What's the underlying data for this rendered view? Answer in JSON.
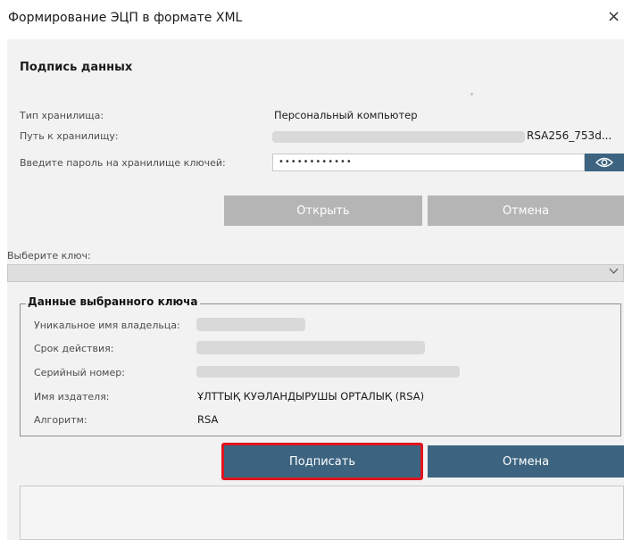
{
  "window": {
    "title": "Формирование ЭЦП в формате XML",
    "close_glyph": "×"
  },
  "section": {
    "heading": "Подпись данных"
  },
  "storage": {
    "type_label": "Тип хранилища:",
    "type_value": "Персональный компьютер",
    "path_label": "Путь к хранилищу:",
    "path_value_visible": "RSA256_753d...",
    "password_label": "Введите пароль на хранилище ключей:",
    "password_value": "••••••••••••"
  },
  "buttons": {
    "open": "Открыть",
    "cancel_top": "Отмена",
    "sign": "Подписать",
    "cancel_bottom": "Отмена"
  },
  "key_select": {
    "label": "Выберите ключ:",
    "value": ""
  },
  "key_details": {
    "group_title": "Данные выбранного ключа",
    "owner_label": "Уникальное имя владельца:",
    "validity_label": "Срок действия:",
    "serial_label": "Серийный номер:",
    "issuer_label": "Имя издателя:",
    "issuer_value": "ҰЛТТЫҚ КУӘЛАНДЫРУШЫ ОРТАЛЫҚ (RSA)",
    "algorithm_label": "Алгоритм:",
    "algorithm_value": "RSA"
  },
  "colors": {
    "primary_button": "#3c6480",
    "disabled_button": "#b5b5b5",
    "highlight_border": "#e0141e",
    "panel_background": "#f2f2f2"
  },
  "icons": {
    "close": "close-icon",
    "eye": "eye-icon",
    "dropdown": "chevron-down-icon"
  }
}
